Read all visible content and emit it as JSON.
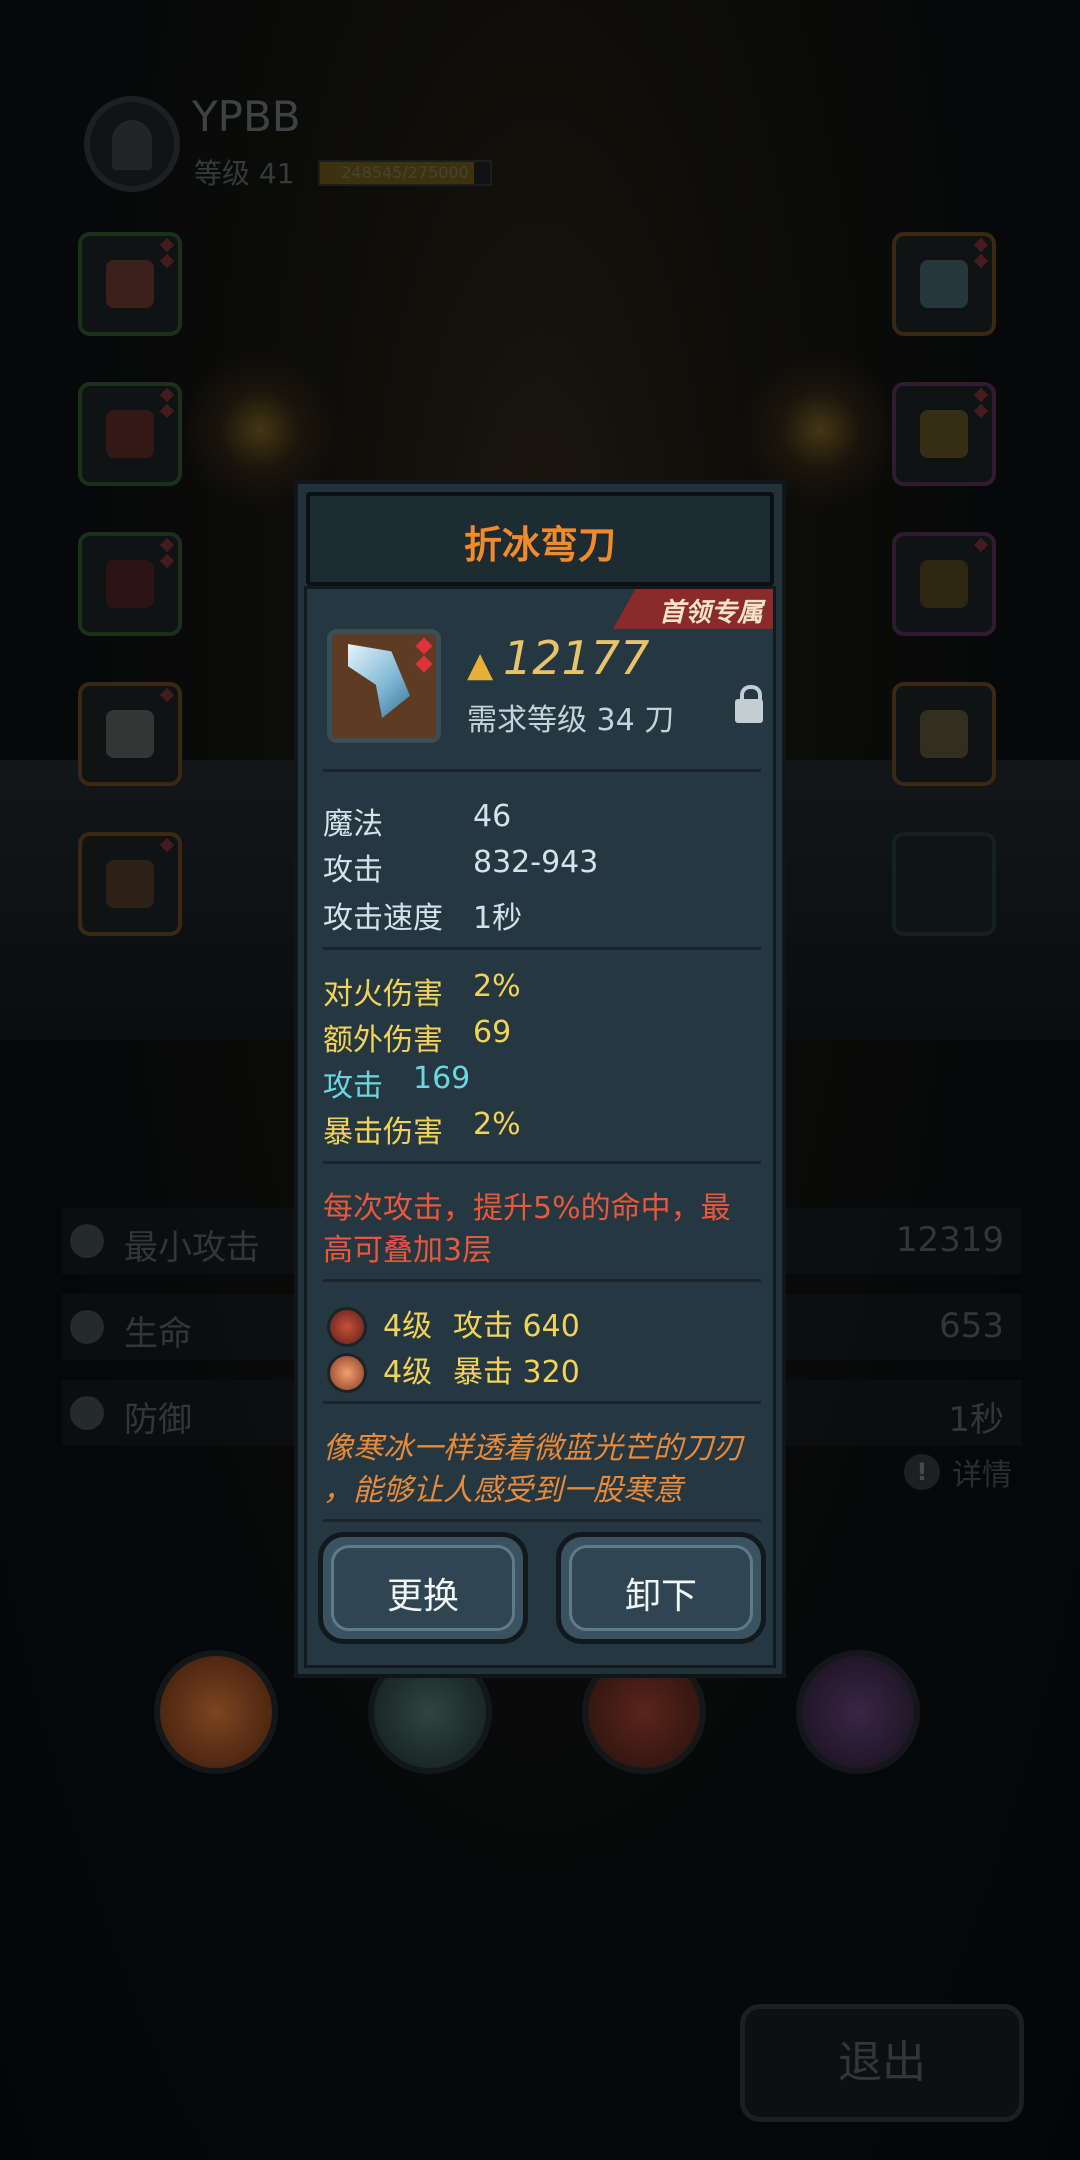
{
  "player": {
    "name": "YPBB",
    "level_label": "等级 41",
    "xp_text": "248545/275000",
    "xp_fraction": 0.904
  },
  "stats": [
    {
      "label": "最小攻击",
      "value": "12319"
    },
    {
      "label": "生命",
      "value": "653"
    },
    {
      "label": "防御",
      "value": "1秒"
    }
  ],
  "detail_label": "详情",
  "exit_label": "退出",
  "dialog": {
    "title": "折冰弯刀",
    "badge": "首领专属",
    "power": "12177",
    "requirement": "需求等级 34    刀",
    "base_stats": [
      {
        "label": "魔法",
        "value": "46"
      },
      {
        "label": "攻击",
        "value": "832-943"
      },
      {
        "label": "攻击速度",
        "value": "1秒"
      }
    ],
    "bonus_stats": [
      {
        "label": "对火伤害",
        "value": "2%"
      },
      {
        "label": "额外伤害",
        "value": "69"
      },
      {
        "label": "攻击",
        "value": "169"
      },
      {
        "label": "暴击伤害",
        "value": "2%"
      }
    ],
    "effect_line1": "每次攻击，提升5%的命中，最",
    "effect_line2": "高可叠加3层",
    "gems": [
      {
        "level": "4级",
        "stat": "攻击 640"
      },
      {
        "level": "4级",
        "stat": "暴击 320"
      }
    ],
    "flavor_line1": "像寒冰一样透着微蓝光芒的刀刃",
    "flavor_line2": "，能够让人感受到一股寒意",
    "replace_label": "更换",
    "unequip_label": "卸下"
  }
}
